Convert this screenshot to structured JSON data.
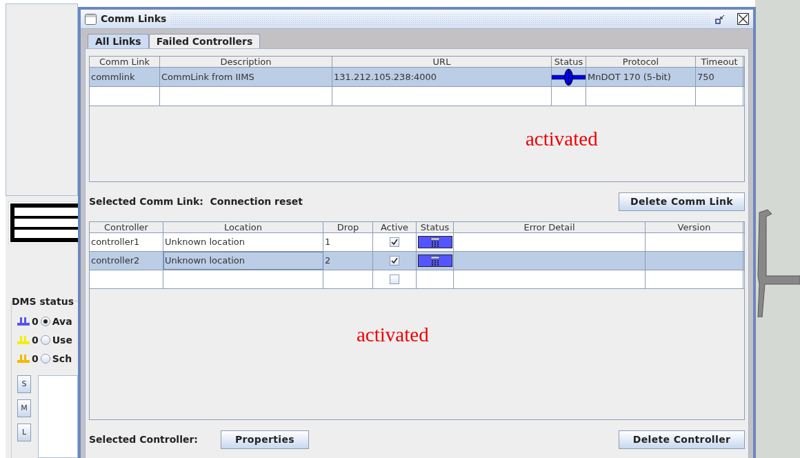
{
  "background": {
    "dms_status": {
      "title": "DMS status",
      "rows": [
        {
          "count": "0",
          "label": "Ava",
          "selected": true,
          "color": "#5555ee"
        },
        {
          "count": "0",
          "label": "Use",
          "selected": false,
          "color": "#f0f000"
        },
        {
          "count": "0",
          "label": "Sch",
          "selected": false,
          "color": "#f5b800"
        }
      ]
    },
    "size_buttons": [
      "S",
      "M",
      "L"
    ]
  },
  "dialog": {
    "title": "Comm Links",
    "tabs": [
      {
        "label": "All Links",
        "selected": true
      },
      {
        "label": "Failed Controllers",
        "selected": false
      }
    ],
    "comm_links": {
      "columns": [
        "Comm Link",
        "Description",
        "URL",
        "Status",
        "Protocol",
        "Timeout"
      ],
      "rows": [
        {
          "comm_link": "commlink",
          "description": "CommLink from IIMS",
          "url": "131.212.105.238:4000",
          "protocol": "MnDOT 170 (5-bit)",
          "timeout": "750",
          "selected": true
        },
        {
          "selected": false
        }
      ],
      "annotation": "activated"
    },
    "selected_comm_link": {
      "label": "Selected Comm Link:",
      "value": "Connection reset"
    },
    "delete_comm_link": "Delete Comm Link",
    "controllers": {
      "columns": [
        "Controller",
        "Location",
        "Drop",
        "Active",
        "Status",
        "Error Detail",
        "Version"
      ],
      "rows": [
        {
          "controller": "controller1",
          "location": "Unknown location",
          "drop": "1",
          "active": true,
          "selected": false
        },
        {
          "controller": "controller2",
          "location": "Unknown location",
          "drop": "2",
          "active": true,
          "selected": true
        },
        {
          "active": false,
          "selected": false
        }
      ],
      "annotation": "activated"
    },
    "selected_controller": "Selected Controller:",
    "properties": "Properties",
    "delete_controller": "Delete Controller"
  }
}
